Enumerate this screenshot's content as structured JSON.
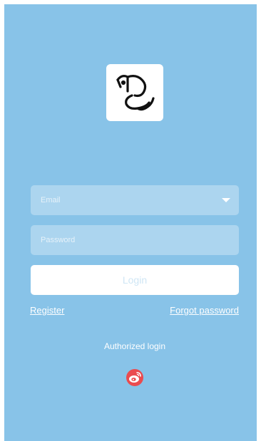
{
  "form": {
    "email_placeholder": "Email",
    "password_placeholder": "Password",
    "login_label": "Login"
  },
  "links": {
    "register": "Register",
    "forgot_password": "Forgot password"
  },
  "social": {
    "label": "Authorized login",
    "icon": "weibo-icon"
  },
  "colors": {
    "background": "#88c3e8",
    "field": "#acd5ef",
    "weibo": "#e6162d"
  }
}
